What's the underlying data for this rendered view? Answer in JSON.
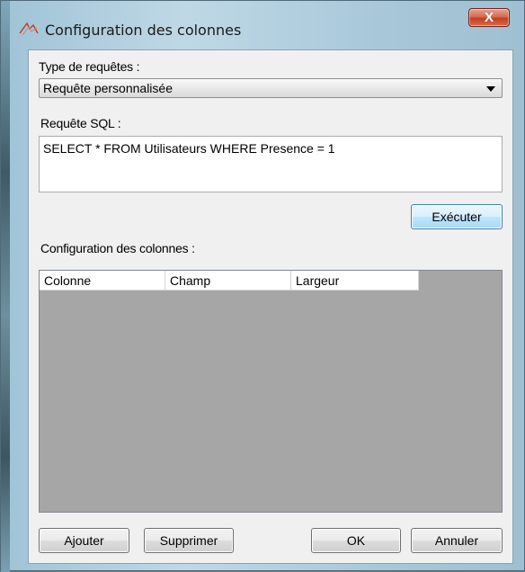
{
  "window": {
    "title": "Configuration des colonnes",
    "close_label": "X"
  },
  "form": {
    "query_type_label": "Type de requêtes :",
    "query_type_value": "Requête personnalisée",
    "sql_label": "Requête SQL :",
    "sql_value": "SELECT * FROM Utilisateurs WHERE Presence = 1",
    "execute_label": "Exécuter",
    "columns_label": "Configuration des colonnes :"
  },
  "grid": {
    "columns": [
      "Colonne",
      "Champ",
      "Largeur"
    ],
    "rows": []
  },
  "buttons": {
    "add": "Ajouter",
    "delete": "Supprimer",
    "ok": "OK",
    "cancel": "Annuler"
  },
  "colors": {
    "grid_background": "#a6a6a6",
    "close_button": "#c2401f"
  }
}
